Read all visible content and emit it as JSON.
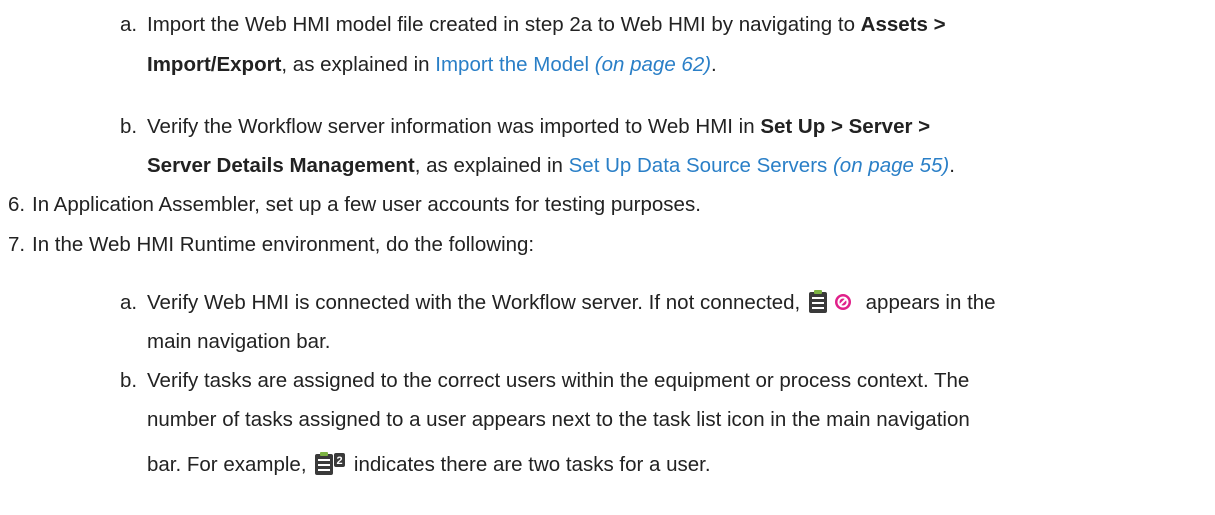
{
  "steps": {
    "a5": {
      "marker": "a.",
      "line1_prefix": "Import the Web HMI model file created in step 2a to Web HMI by navigating to ",
      "line1_bold": "Assets >",
      "line2_bold": "Import/Export",
      "line2_mid": ", as explained in ",
      "line2_link": "Import the Model",
      "line2_pageref": " (on page 62)",
      "line2_end": "."
    },
    "b5": {
      "marker": "b.",
      "line1_prefix": "Verify the Workflow server information was imported to Web HMI in ",
      "line1_bold": "Set Up > Server >",
      "line2_bold": "Server Details Management",
      "line2_mid": ", as explained in ",
      "line2_link": "Set Up Data Source Servers",
      "line2_pageref": " (on page 55)",
      "line2_end": "."
    },
    "s6": {
      "marker": "6.",
      "text": "In Application Assembler, set up a few user accounts for testing purposes."
    },
    "s7": {
      "marker": "7.",
      "text": "In the Web HMI Runtime environment, do the following:"
    },
    "a7": {
      "marker": "a.",
      "line1_prefix": "Verify Web HMI is connected with the Workflow server. If not connected, ",
      "line1_suffix": " appears in the",
      "line2": "main navigation bar."
    },
    "b7": {
      "marker": "b.",
      "line1": "Verify tasks are assigned to the correct users within the equipment or process context. The",
      "line2": "number of tasks assigned to a user appears next to the task list icon in the main navigation",
      "line3_prefix": "bar. For example, ",
      "line3_suffix": " indicates there are two tasks for a user.",
      "task_count": "2"
    }
  },
  "icons": {
    "task_list_disconnected": "task-list-disconnected-icon",
    "task_list_with_count": "task-list-count-icon"
  },
  "colors": {
    "text": "#222222",
    "link": "#2a7fc7",
    "disconnected_badge": "#e0218a",
    "icon_dark": "#3a3a3a",
    "icon_green": "#7cb342"
  }
}
